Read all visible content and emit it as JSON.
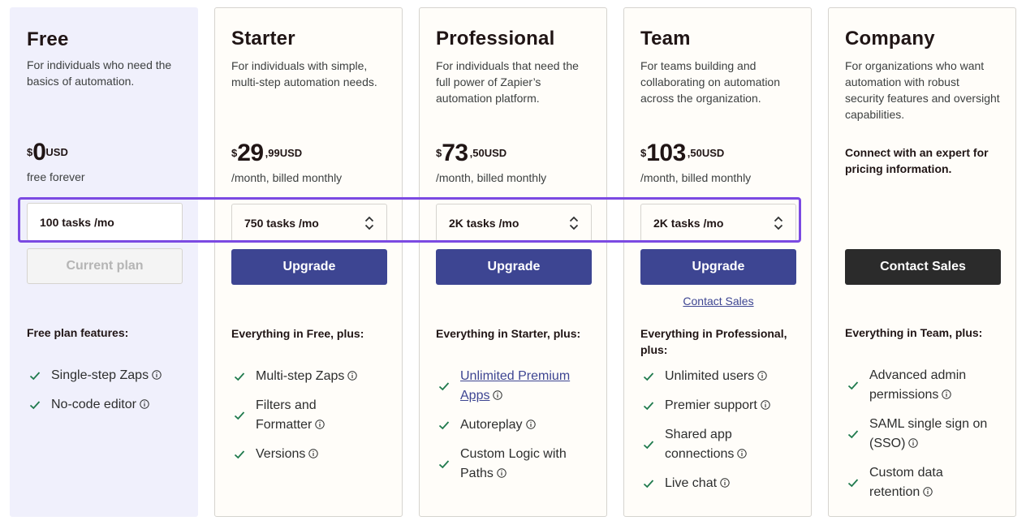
{
  "plans": {
    "free": {
      "name": "Free",
      "desc": "For individuals who need the basics of automation.",
      "currency": "$",
      "price_whole": "0",
      "price_cents": "",
      "price_unit": "USD",
      "billing": "free forever",
      "tasks": "100 tasks /mo",
      "button": "Current plan",
      "features_heading": "Free plan features:",
      "features": [
        "Single-step Zaps",
        "No-code editor"
      ]
    },
    "starter": {
      "name": "Starter",
      "desc": "For individuals with simple, multi-step automation needs.",
      "currency": "$",
      "price_whole": "29",
      "price_cents": ",99",
      "price_unit": "USD",
      "billing": "/month, billed monthly",
      "tasks": "750 tasks /mo",
      "button": "Upgrade",
      "features_heading": "Everything in Free, plus:",
      "features": [
        "Multi-step Zaps",
        "Filters and Formatter",
        "Versions"
      ]
    },
    "professional": {
      "name": "Professional",
      "desc": "For individuals that need the full power of Zapier’s automation platform.",
      "currency": "$",
      "price_whole": "73",
      "price_cents": ",50",
      "price_unit": "USD",
      "billing": "/month, billed monthly",
      "tasks": "2K tasks /mo",
      "button": "Upgrade",
      "features_heading": "Everything in Starter, plus:",
      "features": [
        "Unlimited Premium Apps",
        "Autoreplay",
        "Custom Logic with Paths"
      ]
    },
    "team": {
      "name": "Team",
      "desc": "For teams building and collaborating on automation across the organization.",
      "currency": "$",
      "price_whole": "103",
      "price_cents": ",50",
      "price_unit": "USD",
      "billing": "/month, billed monthly",
      "tasks": "2K tasks /mo",
      "button": "Upgrade",
      "secondary_link": "Contact Sales",
      "features_heading": "Everything in Professional, plus:",
      "features": [
        "Unlimited users",
        "Premier support",
        "Shared app connections",
        "Live chat"
      ]
    },
    "company": {
      "name": "Company",
      "desc": "For organizations who want automation with robust security features and oversight capabilities.",
      "contact_note": "Connect with an expert for pricing information.",
      "button": "Contact Sales",
      "features_heading": "Everything in Team, plus:",
      "features": [
        "Advanced admin permissions",
        "SAML single sign on (SSO)",
        "Custom data retention"
      ]
    }
  },
  "colors": {
    "accent": "#3d4592",
    "highlight": "#7b4ae2",
    "check": "#1f7a4d",
    "free_bg": "#f0f0fc"
  },
  "icons": {
    "check": "check-icon",
    "info": "info-icon",
    "select": "chevron-up-down-icon"
  }
}
